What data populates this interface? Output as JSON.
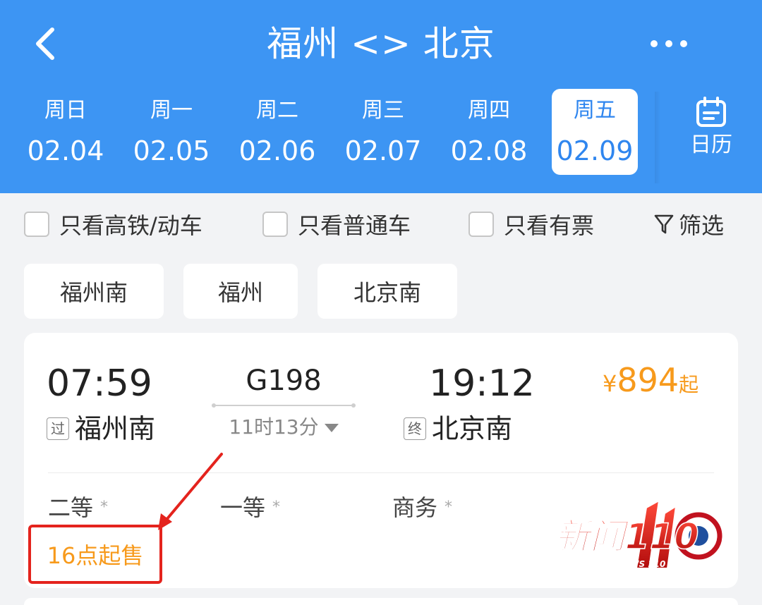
{
  "header": {
    "title": "福州 <> 北京",
    "calendar_label": "日历"
  },
  "dates": [
    {
      "dow": "周日",
      "md": "02.04",
      "active": false
    },
    {
      "dow": "周一",
      "md": "02.05",
      "active": false
    },
    {
      "dow": "周二",
      "md": "02.06",
      "active": false
    },
    {
      "dow": "周三",
      "md": "02.07",
      "active": false
    },
    {
      "dow": "周四",
      "md": "02.08",
      "active": false
    },
    {
      "dow": "周五",
      "md": "02.09",
      "active": true
    }
  ],
  "filters": {
    "high_speed_only": "只看高铁/动车",
    "normal_only": "只看普通车",
    "available_only": "只看有票",
    "filter_label": "筛选"
  },
  "stations": [
    "福州南",
    "福州",
    "北京南"
  ],
  "train": {
    "depart_time": "07:59",
    "depart_tag": "过",
    "depart_station": "福州南",
    "number": "G198",
    "duration": "11时13分",
    "arrive_time": "19:12",
    "arrive_tag": "终",
    "arrive_station": "北京南",
    "price_currency": "¥",
    "price_amount": "894",
    "price_suffix": "起",
    "seats": [
      {
        "name": "二等",
        "mark": "*"
      },
      {
        "name": "一等",
        "mark": "*"
      },
      {
        "name": "商务",
        "mark": "*"
      }
    ],
    "sale_notice": "16点起售"
  },
  "watermark": {
    "text": "新闻110",
    "sub": "NEWS 110"
  },
  "colors": {
    "header_blue": "#3d95f3",
    "price_orange": "#f79a1c",
    "annotation_red": "#e4231d"
  }
}
